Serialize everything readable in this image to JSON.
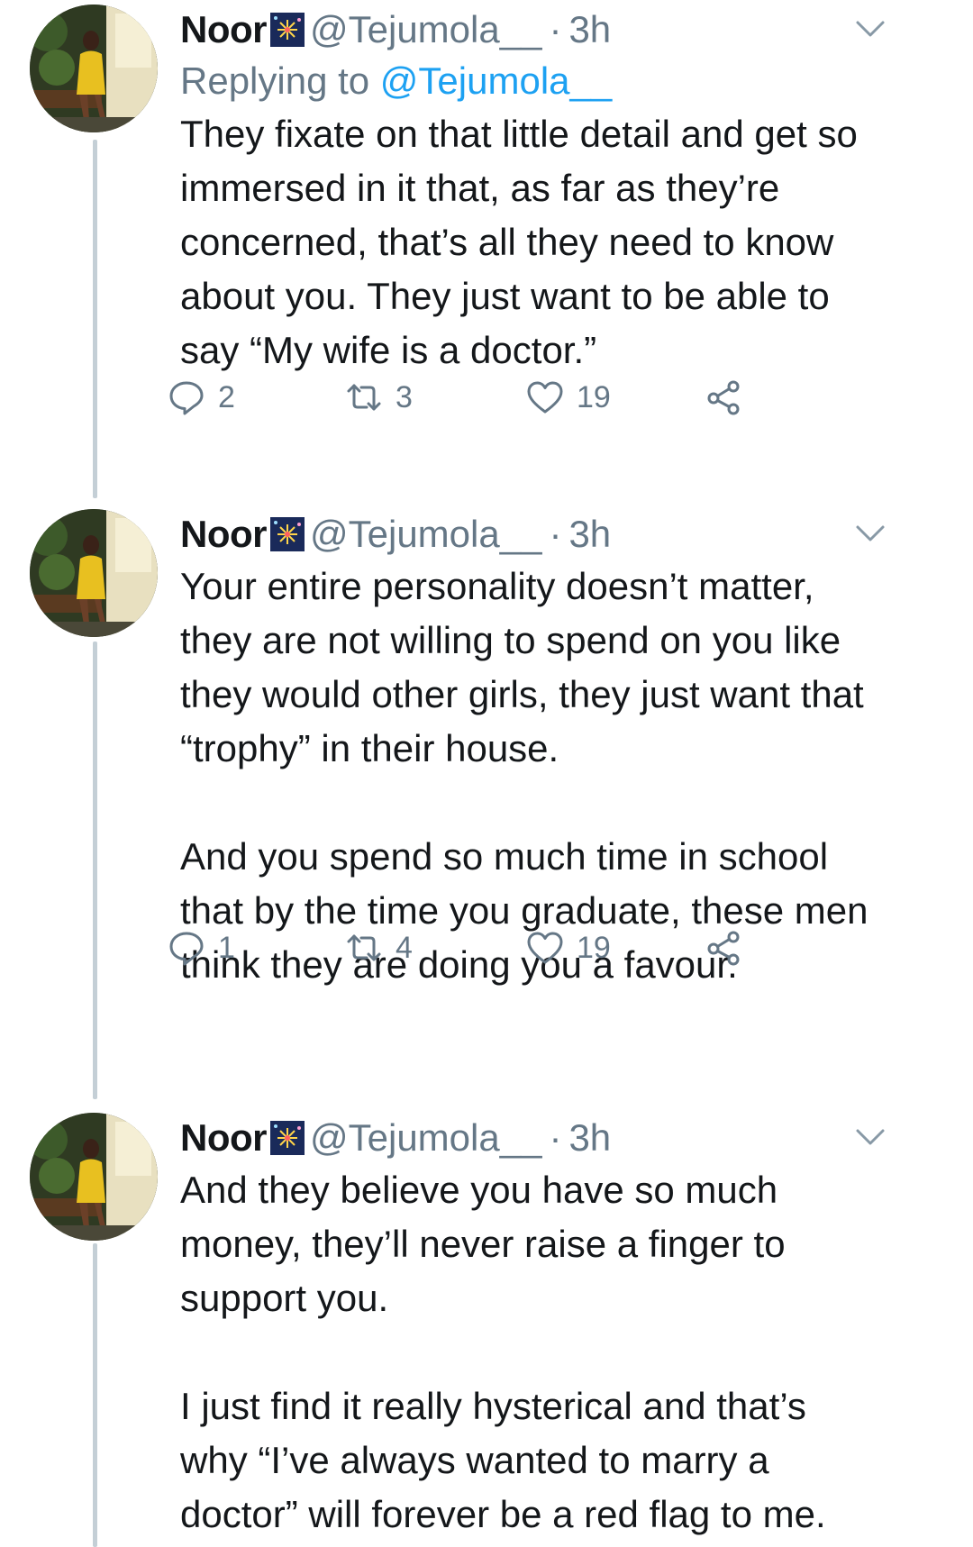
{
  "colors": {
    "text": "#14171a",
    "secondary": "#657786",
    "link": "#1da1f2",
    "thread_line": "#c4cfd6"
  },
  "icons": {
    "reply": "speech-bubble",
    "retweet": "retweet-arrows",
    "like": "heart",
    "share": "share-nodes",
    "menu": "chevron-down",
    "name_emoji": "fireworks"
  },
  "tweets": [
    {
      "name": "Noor",
      "handle": "@Tejumola__",
      "dot": "·",
      "time": "3h",
      "replying_prefix": "Replying to ",
      "replying_handle": "@Tejumola__",
      "text": "They fixate on that little detail and get so\nimmersed in it that, as far as they’re\nconcerned, that’s all they need to know\nabout you. They just want to be able to\nsay “My wife is a doctor.”",
      "replies": "2",
      "retweets": "3",
      "likes": "19"
    },
    {
      "name": "Noor",
      "handle": "@Tejumola__",
      "dot": "·",
      "time": "3h",
      "text": "Your entire personality doesn’t matter,\nthey are not willing to spend on you like\nthey would other girls, they just want that\n“trophy” in their house.\n\nAnd you spend so much time in school\nthat by the time you graduate, these men\nthink they are doing you a favour.",
      "replies": "1",
      "retweets": "4",
      "likes": "19"
    },
    {
      "name": "Noor",
      "handle": "@Tejumola__",
      "dot": "·",
      "time": "3h",
      "text": "And they believe you have so much\nmoney, they’ll never raise a finger to\nsupport you.\n\nI just find it really hysterical and that’s\nwhy “I’ve always wanted to marry a\ndoctor” will forever be a red flag to me."
    }
  ]
}
